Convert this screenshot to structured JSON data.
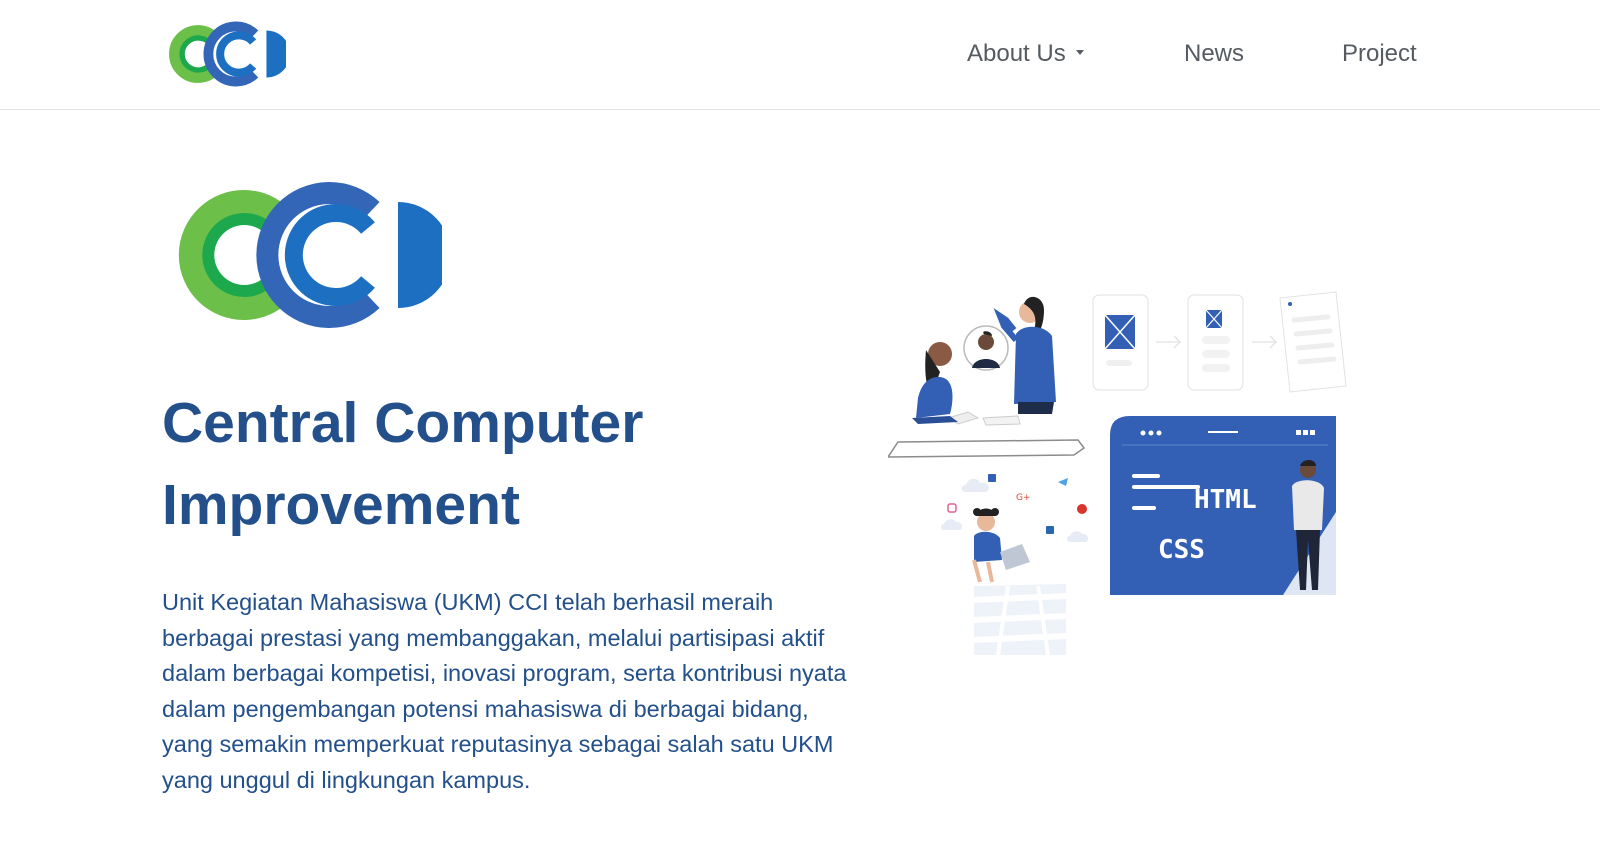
{
  "navbar": {
    "logo_alt": "CCI",
    "items": [
      {
        "label": "About Us",
        "has_dropdown": true
      },
      {
        "label": "News"
      },
      {
        "label": "Project"
      }
    ]
  },
  "hero": {
    "title": "Central Computer Improvement",
    "description": "Unit Kegiatan Mahasiswa (UKM) CCI telah berhasil meraih berbagai prestasi yang membanggakan, melalui partisipasi aktif dalam berbagai kompetisi, inovasi program, serta kontribusi nyata dalam pengembangan potensi mahasiswa di berbagai bidang, yang semakin memperkuat reputasinya sebagai salah satu UKM yang unggul di lingkungan kampus.",
    "illustration": {
      "code_card_line1": "HTML",
      "code_card_line2": "CSS"
    }
  },
  "colors": {
    "brand_blue": "#23508a",
    "logo_green_light": "#6cc04a",
    "logo_green_dark": "#1ea84d",
    "logo_blue": "#1d6fc2",
    "illustration_blue": "#3360b4",
    "nav_text": "#555b61"
  },
  "icons": [
    "cci-logo",
    "caret-down-icon",
    "facebook-icon",
    "twitter-icon",
    "google-plus-icon",
    "instagram-icon",
    "pinterest-icon",
    "linkedin-icon"
  ]
}
